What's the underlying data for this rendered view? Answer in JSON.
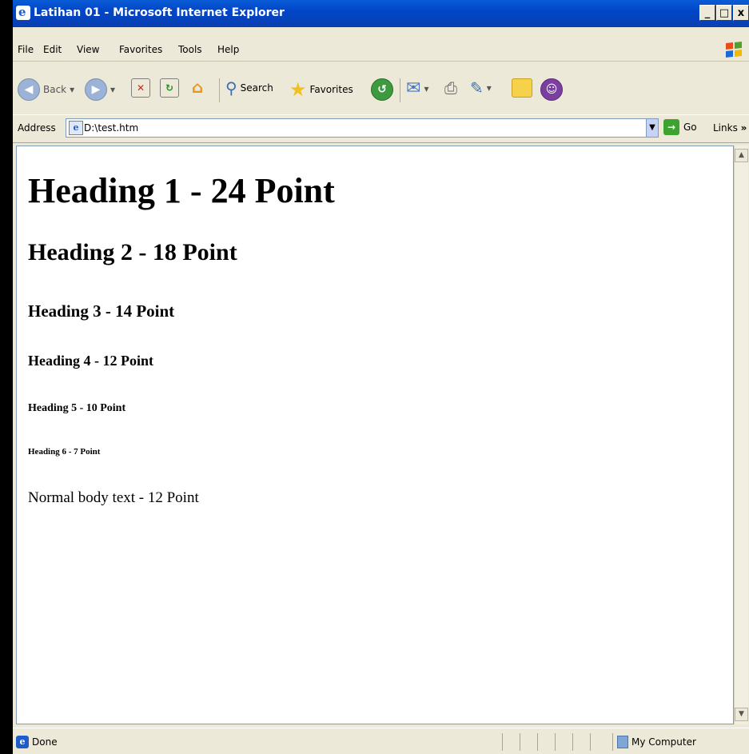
{
  "window": {
    "title": "Latihan 01 - Microsoft Internet Explorer"
  },
  "menu": [
    "File",
    "Edit",
    "View",
    "Favorites",
    "Tools",
    "Help"
  ],
  "toolbar": {
    "back": "Back",
    "search": "Search",
    "favorites": "Favorites"
  },
  "address": {
    "label": "Address",
    "value": "D:\\test.htm",
    "go": "Go",
    "links": "Links"
  },
  "document": {
    "h1": "Heading 1 - 24 Point",
    "h2": "Heading 2 - 18 Point",
    "h3": "Heading 3 - 14 Point",
    "h4": "Heading 4 - 12 Point",
    "h5": "Heading 5 - 10 Point",
    "h6": "Heading 6 - 7 Point",
    "body": "Normal body text - 12 Point"
  },
  "status": {
    "text": "Done",
    "zone": "My Computer"
  },
  "colors": {
    "titlebar": "#0a5bd6",
    "chrome": "#ece9d8",
    "go": "#3ca32f"
  }
}
